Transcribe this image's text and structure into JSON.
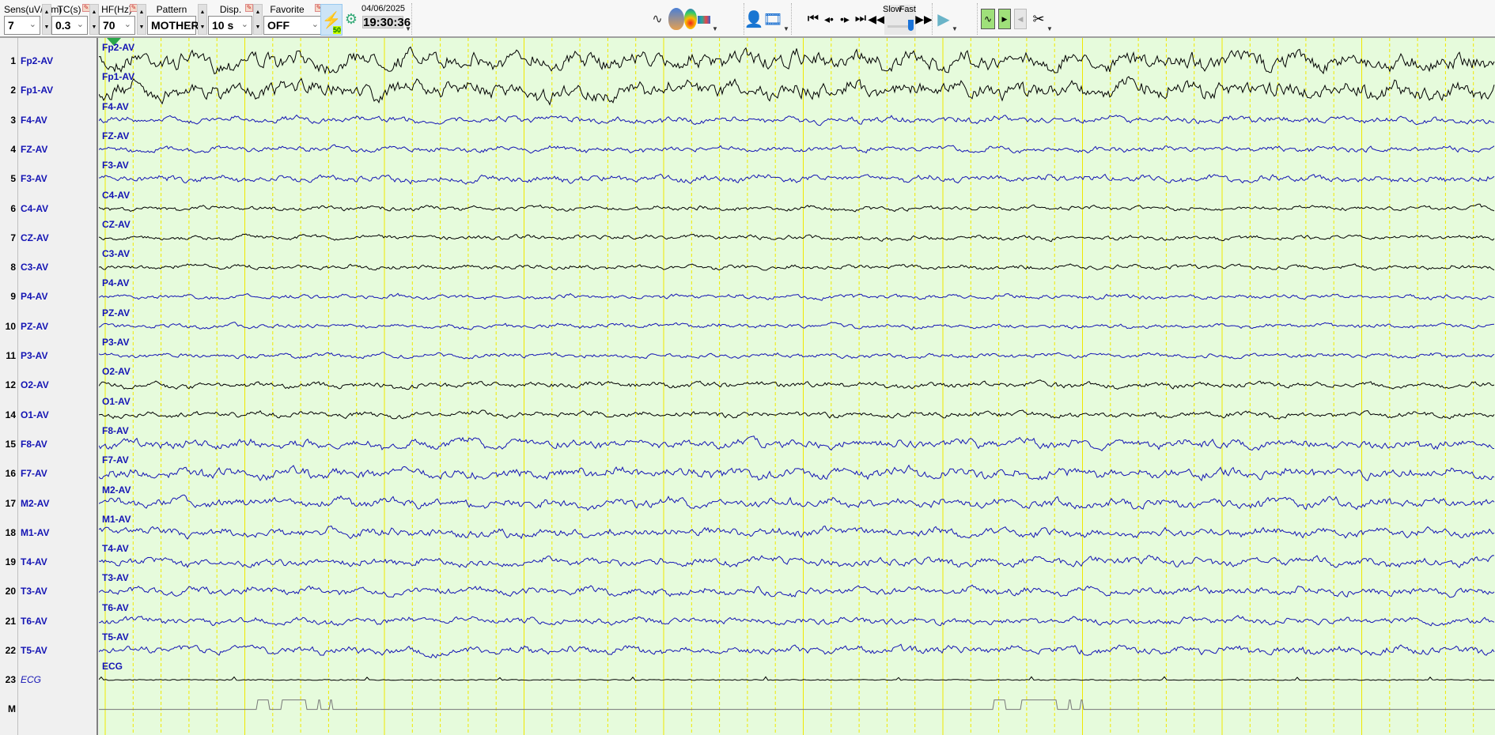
{
  "toolbar": {
    "sens": {
      "label": "Sens(uV/mm)",
      "value": "7"
    },
    "tc": {
      "label": "TC(s)",
      "value": "0.3"
    },
    "hf": {
      "label": "HF(Hz)",
      "value": "70"
    },
    "pattern": {
      "label": "Pattern",
      "value": "MOTHER"
    },
    "disp_length": {
      "label": "Disp. length",
      "value": "10 s"
    },
    "favorite": {
      "label": "Favorite",
      "value": "OFF"
    },
    "notch_badge": "50",
    "date": "04/06/2025",
    "time": "19:30:36",
    "speed": {
      "slow_label": "Slow",
      "fast_label": "Fast",
      "level": 0.9
    }
  },
  "channels": [
    {
      "num": "1",
      "label": "Fp2-AV",
      "color": "#000000"
    },
    {
      "num": "2",
      "label": "Fp1-AV",
      "color": "#000000"
    },
    {
      "num": "3",
      "label": "F4-AV",
      "color": "#1414b4"
    },
    {
      "num": "4",
      "label": "FZ-AV",
      "color": "#1414b4"
    },
    {
      "num": "5",
      "label": "F3-AV",
      "color": "#1414b4"
    },
    {
      "num": "6",
      "label": "C4-AV",
      "color": "#000000"
    },
    {
      "num": "7",
      "label": "CZ-AV",
      "color": "#000000"
    },
    {
      "num": "8",
      "label": "C3-AV",
      "color": "#000000"
    },
    {
      "num": "9",
      "label": "P4-AV",
      "color": "#1414b4"
    },
    {
      "num": "10",
      "label": "PZ-AV",
      "color": "#1414b4"
    },
    {
      "num": "11",
      "label": "P3-AV",
      "color": "#1414b4"
    },
    {
      "num": "12",
      "label": "O2-AV",
      "color": "#000000"
    },
    {
      "num": "14",
      "label": "O1-AV",
      "color": "#000000"
    },
    {
      "num": "15",
      "label": "F8-AV",
      "color": "#1414b4"
    },
    {
      "num": "16",
      "label": "F7-AV",
      "color": "#1414b4"
    },
    {
      "num": "17",
      "label": "M2-AV",
      "color": "#1414b4"
    },
    {
      "num": "18",
      "label": "M1-AV",
      "color": "#1414b4"
    },
    {
      "num": "19",
      "label": "T4-AV",
      "color": "#1414b4"
    },
    {
      "num": "20",
      "label": "T3-AV",
      "color": "#1414b4"
    },
    {
      "num": "21",
      "label": "T6-AV",
      "color": "#1414b4"
    },
    {
      "num": "22",
      "label": "T5-AV",
      "color": "#1414b4"
    },
    {
      "num": "23",
      "label": "ECG",
      "color": "#000000"
    }
  ],
  "marker_row": {
    "label": "M"
  },
  "colors": {
    "plot_bg": "#e6fbdc",
    "grid": "#f0e800",
    "label_blue": "#1414b4"
  }
}
